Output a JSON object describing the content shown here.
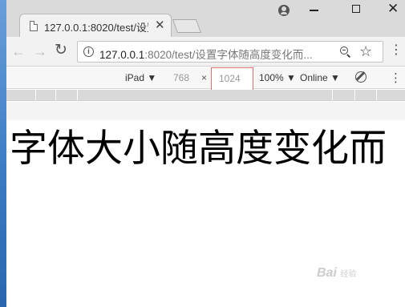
{
  "tab": {
    "title": "127.0.0.1:8020/test/设置",
    "close_glyph": "✕"
  },
  "window": {
    "close_glyph": "✕"
  },
  "omnibox": {
    "url_host": "127.0.0.1",
    "url_rest": ":8020/test/设置字体随高度变化而..."
  },
  "device_toolbar": {
    "device": "iPad ▼",
    "width": "768",
    "times": "×",
    "height": "1024",
    "zoom": "100% ▼",
    "throttle": "Online ▼"
  },
  "page": {
    "heading": "字体大小随高度变化而"
  },
  "watermark": {
    "text": "Bai",
    "subtext": "经验"
  },
  "colors": {
    "chrome_frame": "#dadada",
    "highlight_border": "#e07070"
  }
}
